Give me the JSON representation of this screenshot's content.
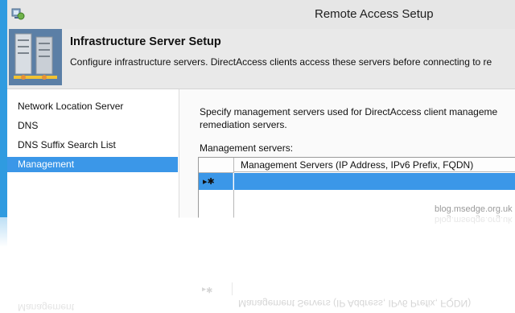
{
  "window": {
    "title": "Remote Access Setup"
  },
  "header": {
    "title": "Infrastructure Server Setup",
    "description": "Configure infrastructure servers. DirectAccess clients access these servers before connecting to re"
  },
  "sidebar": {
    "items": [
      {
        "label": "Network Location Server",
        "active": false
      },
      {
        "label": "DNS",
        "active": false
      },
      {
        "label": "DNS Suffix Search List",
        "active": false
      },
      {
        "label": "Management",
        "active": true
      }
    ]
  },
  "content": {
    "description_line1": "Specify management servers used for DirectAccess client manageme",
    "description_line2": "remediation servers.",
    "management_label": "Management servers:",
    "grid": {
      "column_header": "Management Servers (IP Address, IPv6 Prefix, FQDN)",
      "new_row_marker": "▸✱",
      "rows": []
    }
  },
  "reflection": {
    "grid_marker": "▸✱",
    "column_header": "Management Servers (IP Address, IPv6 Prefix, FQDN)",
    "sidebar_label": "Management"
  },
  "watermark": "blog.msedge.org.uk",
  "colors": {
    "selection": "#3b97e8",
    "window_border": "#2f9be0",
    "titlebar": "#e6e6e6",
    "header_bg": "#e9e9e9"
  },
  "icons": {
    "app": "remote-access-app-icon",
    "header": "server-rack-icon"
  }
}
